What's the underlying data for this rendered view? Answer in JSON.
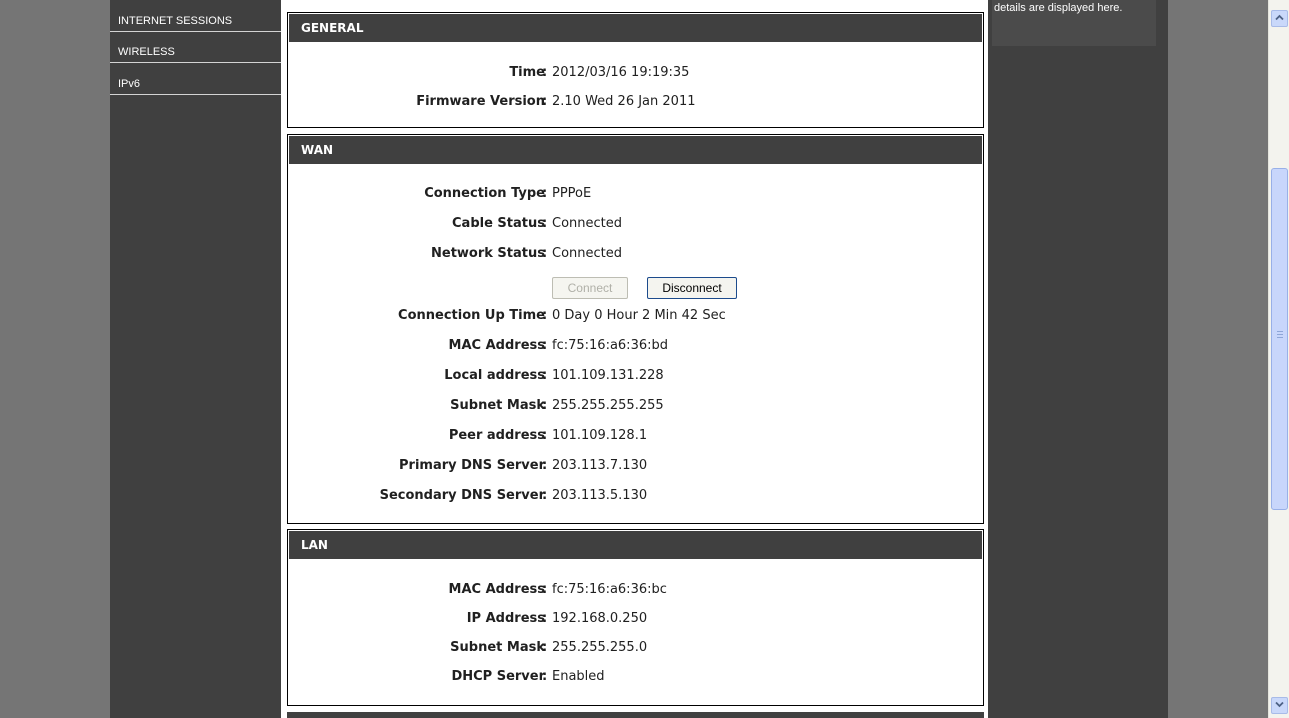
{
  "sidebar": {
    "items": [
      {
        "label": "INTERNET SESSIONS"
      },
      {
        "label": "WIRELESS"
      },
      {
        "label": "IPv6"
      }
    ]
  },
  "help": {
    "text": "details are displayed here."
  },
  "general": {
    "title": "GENERAL",
    "time_label": "Time",
    "time_value": "2012/03/16 19:19:35",
    "firmware_label": "Firmware Version",
    "firmware_value": "2.10 Wed 26 Jan 2011"
  },
  "wan": {
    "title": "WAN",
    "connection_type_label": "Connection Type",
    "connection_type_value": "PPPoE",
    "cable_status_label": "Cable Status",
    "cable_status_value": "Connected",
    "network_status_label": "Network Status",
    "network_status_value": "Connected",
    "connect_button": "Connect",
    "disconnect_button": "Disconnect",
    "up_time_label": "Connection Up Time",
    "up_time_value": "0 Day 0 Hour 2 Min 42 Sec",
    "mac_label": "MAC Address",
    "mac_value": "fc:75:16:a6:36:bd",
    "local_label": "Local address",
    "local_value": "101.109.131.228",
    "subnet_label": "Subnet Mask",
    "subnet_value": "255.255.255.255",
    "peer_label": "Peer address",
    "peer_value": "101.109.128.1",
    "dns1_label": "Primary DNS Server",
    "dns1_value": "203.113.7.130",
    "dns2_label": "Secondary DNS Server",
    "dns2_value": "203.113.5.130"
  },
  "lan": {
    "title": "LAN",
    "mac_label": "MAC Address",
    "mac_value": "fc:75:16:a6:36:bc",
    "ip_label": "IP Address",
    "ip_value": "192.168.0.250",
    "subnet_label": "Subnet Mask",
    "subnet_value": "255.255.255.0",
    "dhcp_label": "DHCP Server",
    "dhcp_value": "Enabled"
  },
  "separator": ":",
  "colors": {
    "header_bg": "#404040",
    "page_bg": "#757575",
    "scrollbar_accent": "#c8d6fb"
  },
  "icons": [
    "scroll-up-icon",
    "scroll-down-icon"
  ]
}
